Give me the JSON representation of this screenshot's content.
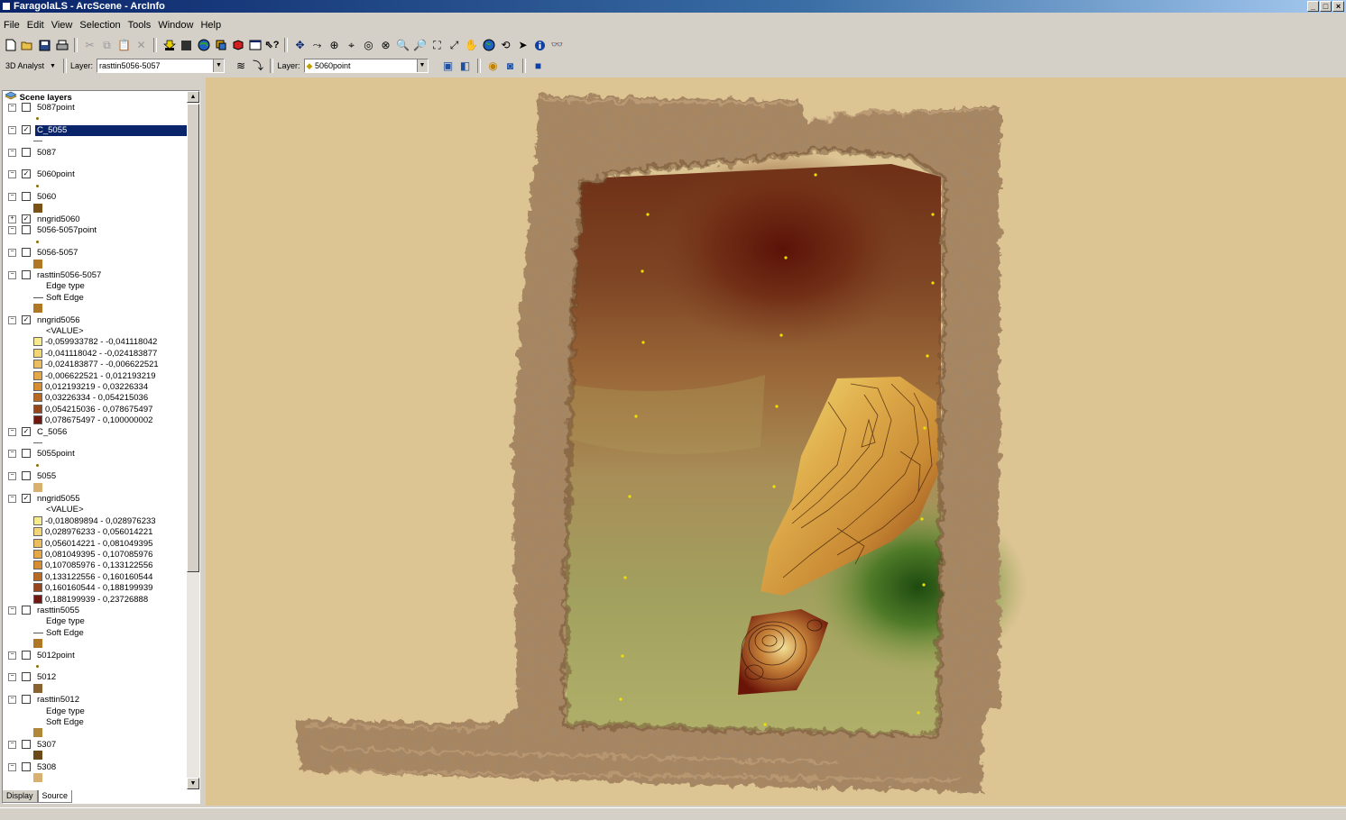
{
  "window": {
    "title": "FaragolaLS - ArcScene - ArcInfo"
  },
  "menu": [
    "File",
    "Edit",
    "View",
    "Selection",
    "Tools",
    "Window",
    "Help"
  ],
  "toolbar2": {
    "analyst_label": "3D Analyst",
    "layer_label": "Layer:",
    "layer_value": "rasttin5056-5057",
    "layer2_label": "Layer:",
    "layer2_value": "5060point"
  },
  "toc": {
    "header": "Scene layers",
    "rows": [
      {
        "kind": "layer",
        "name": "5087point",
        "checked": false,
        "expanded": true,
        "selected": false
      },
      {
        "kind": "sym",
        "sym": "dot"
      },
      {
        "kind": "layer",
        "name": "C_5055",
        "checked": true,
        "expanded": true,
        "selected": true
      },
      {
        "kind": "sym",
        "sym": "line"
      },
      {
        "kind": "layer",
        "name": "5087",
        "checked": false,
        "expanded": true,
        "selected": false
      },
      {
        "kind": "sym",
        "sym": "blank"
      },
      {
        "kind": "layer",
        "name": "5060point",
        "checked": true,
        "expanded": true,
        "selected": false
      },
      {
        "kind": "sym",
        "sym": "dot"
      },
      {
        "kind": "layer",
        "name": "5060",
        "checked": false,
        "expanded": true,
        "selected": false
      },
      {
        "kind": "sym",
        "sym": "swatch",
        "color": "#7a5218"
      },
      {
        "kind": "layer",
        "name": "nngrid5060",
        "checked": true,
        "expanded": false,
        "selected": false
      },
      {
        "kind": "layer",
        "name": "5056-5057point",
        "checked": false,
        "expanded": true,
        "selected": false
      },
      {
        "kind": "sym",
        "sym": "dot"
      },
      {
        "kind": "layer",
        "name": "5056-5057",
        "checked": false,
        "expanded": true,
        "selected": false
      },
      {
        "kind": "sym",
        "sym": "swatch",
        "color": "#b07824"
      },
      {
        "kind": "layer",
        "name": "rasttin5056-5057",
        "checked": false,
        "expanded": true,
        "selected": false
      },
      {
        "kind": "text",
        "text": "Edge type"
      },
      {
        "kind": "text",
        "text": "Soft Edge",
        "line": true
      },
      {
        "kind": "sym",
        "sym": "swatch",
        "color": "#b07824"
      },
      {
        "kind": "layer",
        "name": "nngrid5056",
        "checked": true,
        "expanded": true,
        "selected": false
      },
      {
        "kind": "text",
        "text": "<VALUE>"
      },
      {
        "kind": "class",
        "text": "-0,059933782 - -0,041118042",
        "color": "#f6ea8c"
      },
      {
        "kind": "class",
        "text": "-0,041118042 - -0,024183877",
        "color": "#f2d576"
      },
      {
        "kind": "class",
        "text": "-0,024183877 - -0,006622521",
        "color": "#ecbd5c"
      },
      {
        "kind": "class",
        "text": "-0,006622521 - 0,012193219",
        "color": "#e6a746"
      },
      {
        "kind": "class",
        "text": "0,012193219 - 0,03226334",
        "color": "#d88c30"
      },
      {
        "kind": "class",
        "text": "0,03226334 - 0,054215036",
        "color": "#b86a22"
      },
      {
        "kind": "class",
        "text": "0,054215036 - 0,078675497",
        "color": "#96461a"
      },
      {
        "kind": "class",
        "text": "0,078675497 - 0,100000002",
        "color": "#701810"
      },
      {
        "kind": "layer",
        "name": "C_5056",
        "checked": true,
        "expanded": true,
        "selected": false
      },
      {
        "kind": "sym",
        "sym": "line"
      },
      {
        "kind": "layer",
        "name": "5055point",
        "checked": false,
        "expanded": true,
        "selected": false
      },
      {
        "kind": "sym",
        "sym": "dot"
      },
      {
        "kind": "layer",
        "name": "5055",
        "checked": false,
        "expanded": true,
        "selected": false
      },
      {
        "kind": "sym",
        "sym": "swatch",
        "color": "#d8b070"
      },
      {
        "kind": "layer",
        "name": "nngrid5055",
        "checked": true,
        "expanded": true,
        "selected": false
      },
      {
        "kind": "text",
        "text": "<VALUE>"
      },
      {
        "kind": "class",
        "text": "-0,018089894 - 0,028976233",
        "color": "#f6ea8c"
      },
      {
        "kind": "class",
        "text": "0,028976233 - 0,056014221",
        "color": "#f2d576"
      },
      {
        "kind": "class",
        "text": "0,056014221 - 0,081049395",
        "color": "#ecbd5c"
      },
      {
        "kind": "class",
        "text": "0,081049395 - 0,107085976",
        "color": "#e6a746"
      },
      {
        "kind": "class",
        "text": "0,107085976 - 0,133122556",
        "color": "#d88c30"
      },
      {
        "kind": "class",
        "text": "0,133122556 - 0,160160544",
        "color": "#b86a22"
      },
      {
        "kind": "class",
        "text": "0,160160544 - 0,188199939",
        "color": "#96461a"
      },
      {
        "kind": "class",
        "text": "0,188199939 - 0,23726888",
        "color": "#701810"
      },
      {
        "kind": "layer",
        "name": "rasttin5055",
        "checked": false,
        "expanded": true,
        "selected": false
      },
      {
        "kind": "text",
        "text": "Edge type"
      },
      {
        "kind": "text",
        "text": "Soft Edge",
        "line": true
      },
      {
        "kind": "sym",
        "sym": "swatch",
        "color": "#b07824"
      },
      {
        "kind": "layer",
        "name": "5012point",
        "checked": false,
        "expanded": true,
        "selected": false
      },
      {
        "kind": "sym",
        "sym": "dot"
      },
      {
        "kind": "layer",
        "name": "5012",
        "checked": false,
        "expanded": true,
        "selected": false
      },
      {
        "kind": "sym",
        "sym": "swatch",
        "color": "#8a6230"
      },
      {
        "kind": "layer",
        "name": "rasttin5012",
        "checked": false,
        "expanded": true,
        "selected": false
      },
      {
        "kind": "text",
        "text": "Edge type"
      },
      {
        "kind": "text",
        "text": "Soft Edge"
      },
      {
        "kind": "sym",
        "sym": "swatch",
        "color": "#b08838"
      },
      {
        "kind": "layer",
        "name": "5307",
        "checked": false,
        "expanded": true,
        "selected": false
      },
      {
        "kind": "sym",
        "sym": "swatch",
        "color": "#6a4a18"
      },
      {
        "kind": "layer",
        "name": "5308",
        "checked": false,
        "expanded": true,
        "selected": false
      },
      {
        "kind": "sym",
        "sym": "swatch",
        "color": "#d8b070"
      }
    ]
  },
  "tabs": [
    "Display",
    "Source"
  ],
  "colors": {
    "scene_bg": "#dcc493",
    "wall": "#a07e58",
    "selection": "#0a246a"
  }
}
